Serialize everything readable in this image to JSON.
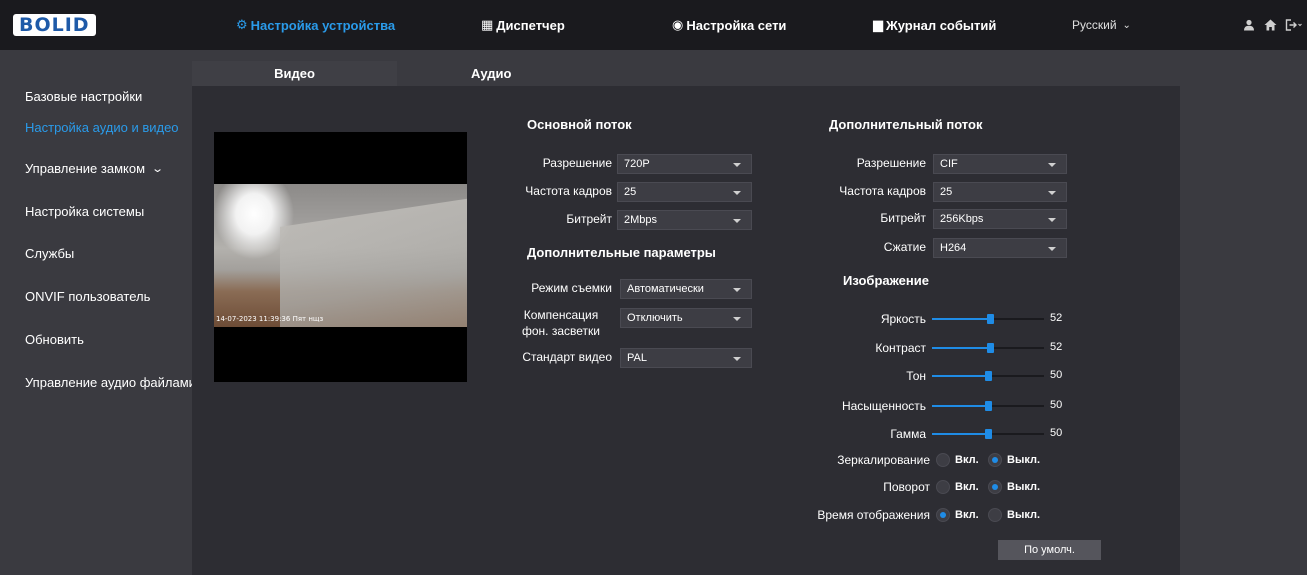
{
  "topbar": {
    "logo": "BOLID",
    "nav": [
      {
        "icon": "⚙",
        "label": "Настройка устройства",
        "active": true
      },
      {
        "icon": "▦",
        "label": "Диспетчер"
      },
      {
        "icon": "◉",
        "label": "Настройка сети"
      },
      {
        "icon": "▆",
        "label": "Журнал событий"
      }
    ],
    "language": "Русский",
    "language_caret": "⌄",
    "icons": [
      "user-icon",
      "home-icon",
      "logout-icon"
    ]
  },
  "sidebar": {
    "items": [
      {
        "label": "Базовые настройки"
      },
      {
        "label": "Настройка аудио и видео",
        "active": true
      },
      {
        "label": "Управление замком",
        "chevron": "⌄"
      },
      {
        "label": "Настройка системы"
      },
      {
        "label": "Службы"
      },
      {
        "label": "ONVIF пользователь"
      },
      {
        "label": "Обновить"
      },
      {
        "label": "Управление аудио файлами"
      }
    ]
  },
  "tabs": {
    "video": "Видео",
    "audio": "Аудио"
  },
  "preview": {
    "timestamp": "14-07-2023 11:39:36 Пят нщз"
  },
  "main_stream": {
    "title": "Основной поток",
    "resolution": {
      "label": "Разрешение",
      "value": "720P"
    },
    "framerate": {
      "label": "Частота кадров",
      "value": "25"
    },
    "bitrate": {
      "label": "Битрейт",
      "value": "2Mbps"
    }
  },
  "extra_params": {
    "title": "Дополнительные параметры",
    "shooting_mode": {
      "label": "Режим съемки",
      "value": "Автоматически"
    },
    "backlight": {
      "label": "Компенсация фон. засветки",
      "value": "Отключить"
    },
    "video_standard": {
      "label": "Стандарт видео",
      "value": "PAL"
    }
  },
  "sub_stream": {
    "title": "Дополнительный поток",
    "resolution": {
      "label": "Разрешение",
      "value": "CIF"
    },
    "framerate": {
      "label": "Частота кадров",
      "value": "25"
    },
    "bitrate": {
      "label": "Битрейт",
      "value": "256Kbps"
    },
    "compression": {
      "label": "Сжатие",
      "value": "H264"
    }
  },
  "image": {
    "title": "Изображение",
    "sliders": [
      {
        "label": "Яркость",
        "value": "52",
        "level": 0.52
      },
      {
        "label": "Контраст",
        "value": "52",
        "level": 0.52
      },
      {
        "label": "Тон",
        "value": "50",
        "level": 0.5
      },
      {
        "label": "Насыщенность",
        "value": "50",
        "level": 0.5
      },
      {
        "label": "Гамма",
        "value": "50",
        "level": 0.5
      }
    ],
    "mirror": {
      "label": "Зеркалирование",
      "on": "Вкл.",
      "off": "Выкл.",
      "selected": "off"
    },
    "rotate": {
      "label": "Поворот",
      "on": "Вкл.",
      "off": "Выкл.",
      "selected": "off"
    },
    "show_time": {
      "label": "Время отображения",
      "on": "Вкл.",
      "off": "Выкл.",
      "selected": "on"
    }
  },
  "default_button": "По умолч.",
  "colors": {
    "accent": "#2a9bea",
    "slider": "#1f8ce6",
    "panel": "#2d2d33",
    "topbar": "#1a1a1e"
  }
}
